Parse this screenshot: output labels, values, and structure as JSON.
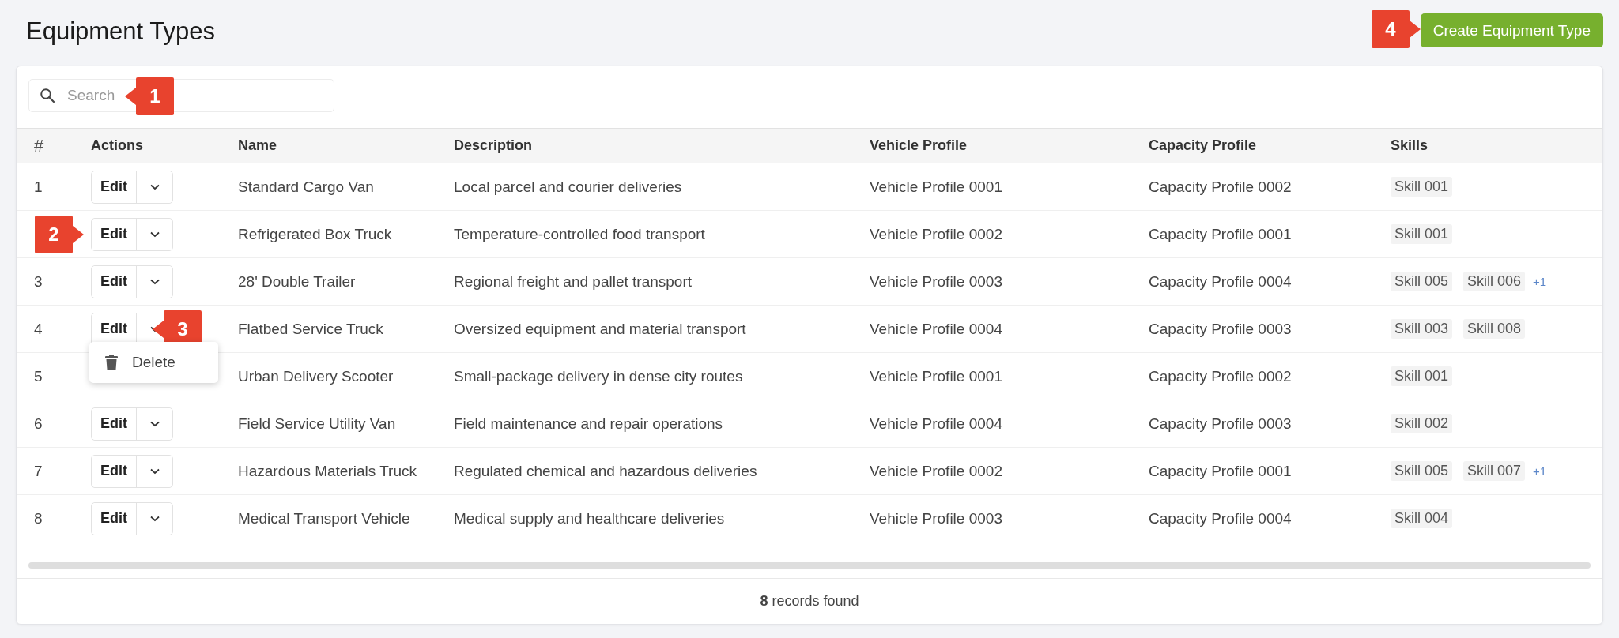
{
  "title": "Equipment Types",
  "create_button": {
    "label": "Create Equipment Type",
    "callout": "4"
  },
  "search": {
    "placeholder": "Search",
    "callout": "1"
  },
  "columns": [
    "#",
    "Actions",
    "Name",
    "Description",
    "Vehicle Profile",
    "Capacity Profile",
    "Skills"
  ],
  "rows": [
    {
      "number": "1",
      "edit": "Edit",
      "name": "Standard Cargo Van",
      "description": "Local parcel and courier deliveries",
      "vehicle_profile": "Vehicle Profile 0001",
      "capacity_profile": "Capacity Profile 0002",
      "skills": [
        "Skill 001"
      ]
    },
    {
      "edit": "Edit",
      "edit_callout": "2",
      "name": "Refrigerated Box Truck",
      "description": "Temperature-controlled food transport",
      "vehicle_profile": "Vehicle Profile 0002",
      "capacity_profile": "Capacity Profile 0001",
      "skills": [
        "Skill 001"
      ]
    },
    {
      "number": "3",
      "edit": "Edit",
      "name": "28' Double Trailer",
      "description": "Regional freight and pallet transport",
      "vehicle_profile": "Vehicle Profile 0003",
      "capacity_profile": "Capacity Profile 0004",
      "skills": [
        "Skill 005",
        "Skill 006"
      ],
      "more": "+1"
    },
    {
      "number": "4",
      "edit": "Edit",
      "toggle_callout": "3",
      "menu": [
        {
          "label": "Delete"
        }
      ],
      "name": "Flatbed Service Truck",
      "description": "Oversized equipment and material transport",
      "vehicle_profile": "Vehicle Profile 0004",
      "capacity_profile": "Capacity Profile 0003",
      "skills": [
        "Skill 003",
        "Skill 008"
      ]
    },
    {
      "number": "5",
      "name": "Urban Delivery Scooter",
      "description": "Small-package delivery in dense city routes",
      "vehicle_profile": "Vehicle Profile 0001",
      "capacity_profile": "Capacity Profile 0002",
      "skills": [
        "Skill 001"
      ]
    },
    {
      "number": "6",
      "edit": "Edit",
      "name": "Field Service Utility Van",
      "description": "Field maintenance and repair operations",
      "vehicle_profile": "Vehicle Profile 0004",
      "capacity_profile": "Capacity Profile 0003",
      "skills": [
        "Skill 002"
      ]
    },
    {
      "number": "7",
      "edit": "Edit",
      "name": "Hazardous Materials Truck",
      "description": "Regulated chemical and hazardous deliveries",
      "vehicle_profile": "Vehicle Profile 0002",
      "capacity_profile": "Capacity Profile 0001",
      "skills": [
        "Skill 005",
        "Skill 007"
      ],
      "more": "+1"
    },
    {
      "number": "8",
      "edit": "Edit",
      "name": "Medical Transport Vehicle",
      "description": "Medical supply and healthcare deliveries",
      "vehicle_profile": "Vehicle Profile 0003",
      "capacity_profile": "Capacity Profile 0004",
      "skills": [
        "Skill 004"
      ]
    }
  ],
  "footer": "**8** records found"
}
